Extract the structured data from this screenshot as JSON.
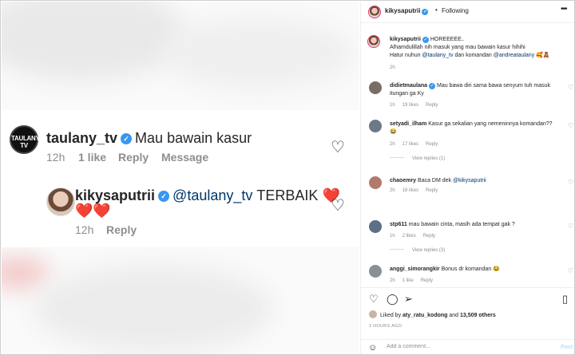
{
  "screenshot": {
    "top_comment": {
      "username": "taulany_tv",
      "avatar_text": "TAULANY TV",
      "text": "Mau bawain kasur",
      "time": "12h",
      "likes": "1 like",
      "reply": "Reply",
      "message": "Message"
    },
    "reply_comment": {
      "username": "kikysaputrii",
      "mention": "@taulany_tv",
      "text": "TERBAIK",
      "hearts_line1": "❤️",
      "hearts_line2": "❤️❤️",
      "time": "12h",
      "reply": "Reply"
    }
  },
  "header": {
    "username": "kikysaputrii",
    "dot": "•",
    "follow_status": "Following",
    "more_icon": "more-horizontal-icon"
  },
  "caption": {
    "username": "kikysaputrii",
    "text_before": "HOREEEEE..\nAlhamdulillah nih masuk yang mau bawain kasur hihihi\nHatur nuhun ",
    "mention1": "@taulany_tv",
    "text_mid": " dan komandan ",
    "mention2": "@andreataulany",
    "emoji": "🥰🧸",
    "time": "2h"
  },
  "comments": [
    {
      "username": "didietmaulana",
      "verified": true,
      "text": "Mau bawa diri sama bawa senyum tuh masuk itungan ga Ky",
      "time": "1h",
      "likes": "19 likes",
      "reply": "Reply"
    },
    {
      "username": "setyadi_ilham",
      "text": "Kasur ga sekalian yang nemeninnya komandan??😂",
      "time": "2h",
      "likes": "17 likes",
      "reply": "Reply",
      "view_replies": "View replies (1)"
    },
    {
      "username": "chaoemry",
      "text": "Baca DM dek ",
      "mention": "@kikysaputrii",
      "time": "2h",
      "likes": "18 likes",
      "reply": "Reply"
    },
    {
      "username": "stp611",
      "text": "mau bawain cinta, masih ada tempat gak ?",
      "time": "1h",
      "likes": "2 likes",
      "reply": "Reply",
      "view_replies": "View replies (3)"
    },
    {
      "username": "anggi_simorangkir",
      "text": "Bonus dr komandan 😂",
      "time": "2h",
      "likes": "1 like",
      "reply": "Reply"
    }
  ],
  "actions": {
    "liked_by_prefix": "Liked by ",
    "liked_by_user": "aty_ratu_kodong",
    "liked_by_mid": " and ",
    "liked_by_count": "13,509 others",
    "time_ago": "2 HOURS AGO",
    "comment_placeholder": "Add a comment...",
    "post_label": "Post"
  },
  "colors": {
    "verified": "#3897f0",
    "mention": "#00376b",
    "post_disabled": "#b2dffc"
  }
}
